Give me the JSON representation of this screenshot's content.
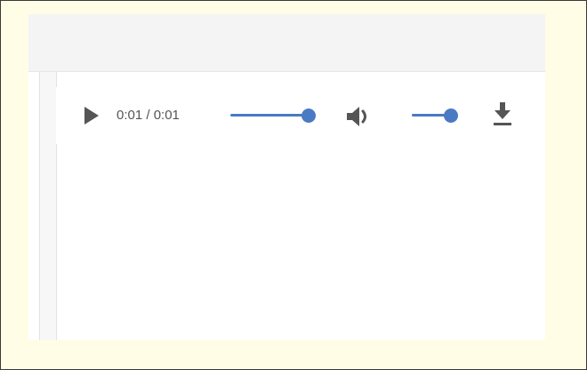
{
  "player": {
    "time_display": "0:01 / 0:01",
    "seek_progress": 1.0,
    "volume_level": 1.0,
    "icons": {
      "play": "play-icon",
      "volume": "volume-icon",
      "download": "download-icon"
    },
    "colors": {
      "accent": "#4a7ac4",
      "icon": "#555555",
      "frame_background": "#fffde6",
      "header_background": "#f4f4f4"
    }
  }
}
